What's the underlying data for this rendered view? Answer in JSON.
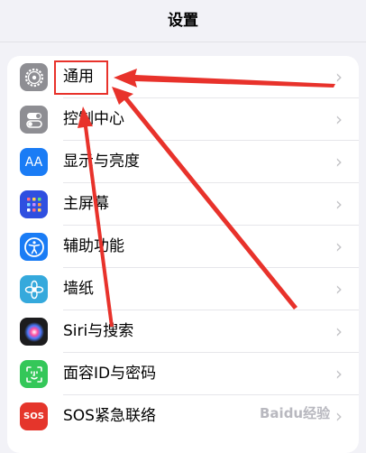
{
  "nav": {
    "title": "设置"
  },
  "settings": {
    "items": [
      {
        "label": "通用",
        "icon": "gear-icon",
        "color": "#8e8e93"
      },
      {
        "label": "控制中心",
        "icon": "toggles-icon",
        "color": "#8e8e93"
      },
      {
        "label": "显示与亮度",
        "icon": "text-size-icon",
        "color": "#1a7cf5",
        "icon_text": "AA"
      },
      {
        "label": "主屏幕",
        "icon": "home-grid-icon",
        "color": "#2f4fe0"
      },
      {
        "label": "辅助功能",
        "icon": "accessibility-icon",
        "color": "#1a7cf5"
      },
      {
        "label": "墙纸",
        "icon": "flower-icon",
        "color": "#35a9dc"
      },
      {
        "label": "Siri与搜索",
        "icon": "siri-icon",
        "color": "#1c1c1e"
      },
      {
        "label": "面容ID与密码",
        "icon": "face-id-icon",
        "color": "#34c759"
      },
      {
        "label": "SOS紧急联络",
        "icon": "sos-icon",
        "color": "#e5352b",
        "icon_text": "SOS"
      }
    ],
    "chevron": "›"
  },
  "annotation": {
    "color": "#e8322b"
  },
  "watermark": {
    "text": "Baidu经验"
  }
}
